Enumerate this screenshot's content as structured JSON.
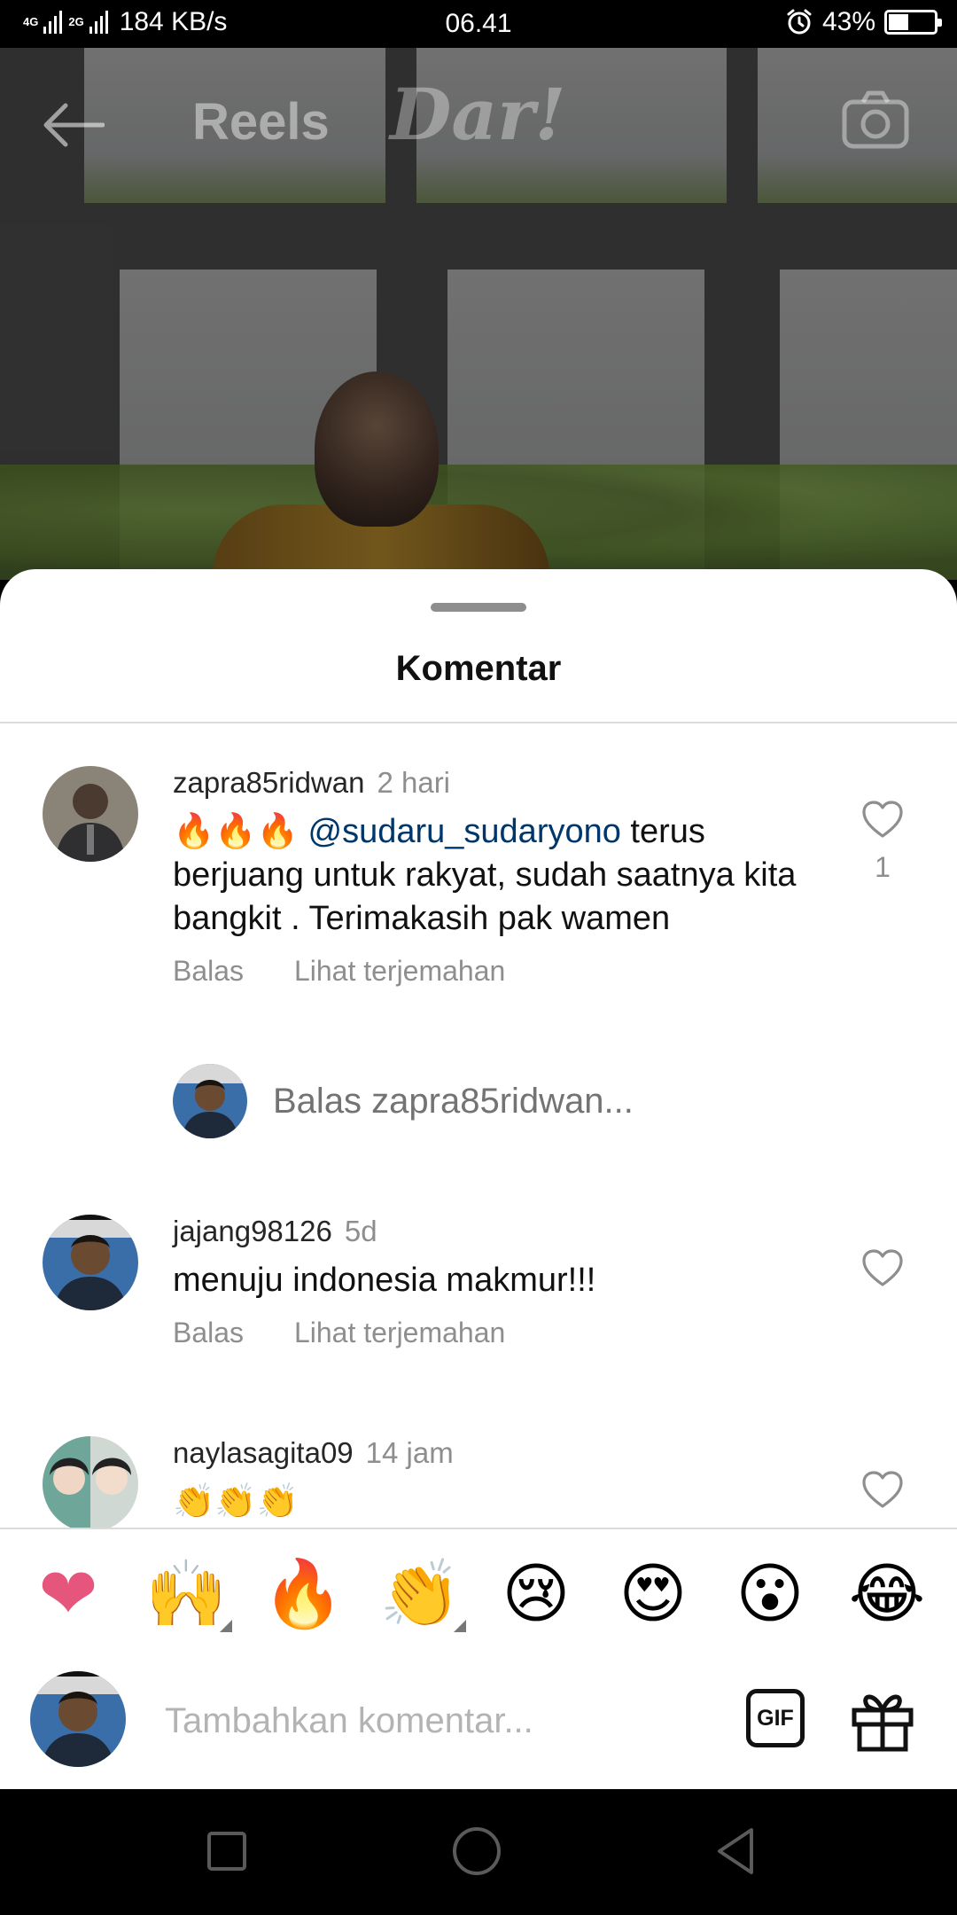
{
  "status_bar": {
    "network_1": "4G",
    "network_2": "2G",
    "speed": "184 KB/s",
    "time": "06.41",
    "battery_percent": "43%",
    "battery_level": 0.43,
    "icons": [
      "signal-icon",
      "alarm-icon",
      "battery-icon"
    ]
  },
  "header": {
    "title": "Reels",
    "back_icon": "arrow-left-icon",
    "camera_icon": "camera-icon",
    "watermark": "Dar!"
  },
  "sheet": {
    "title": "Komentar",
    "comments": [
      {
        "username": "zapra85ridwan",
        "time": "2 hari",
        "emoji_prefix": "🔥🔥🔥",
        "mention": "@sudaru_sudaryono",
        "text": " terus berjuang untuk rakyat, sudah saatnya kita bangkit . Terimakasih pak wamen",
        "reply_label": "Balas",
        "translate_label": "Lihat terjemahan",
        "like_count": "1"
      },
      {
        "username": "jajang98126",
        "time": "5d",
        "text": "menuju indonesia makmur!!!",
        "reply_label": "Balas",
        "translate_label": "Lihat terjemahan"
      },
      {
        "username": "naylasagita09",
        "time": "14 jam",
        "text": "👏👏👏"
      }
    ],
    "reply_placeholder": "Balas zapra85ridwan..."
  },
  "emoji_bar": [
    "❤",
    "🙌",
    "🔥",
    "👏",
    "😢",
    "😍",
    "😮",
    "😂"
  ],
  "add_comment": {
    "placeholder": "Tambahkan komentar...",
    "gif_label": "GIF",
    "gift_icon": "gift-icon"
  },
  "nav_bar": {
    "icons": [
      "square-recents-icon",
      "circle-home-icon",
      "triangle-back-icon"
    ]
  },
  "colors": {
    "mention": "#00376b",
    "secondary_text": "#8e8e8e",
    "heart_pink": "#e5557c"
  }
}
